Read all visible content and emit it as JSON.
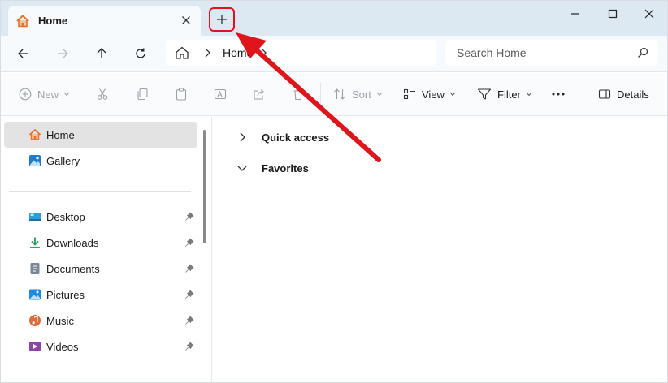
{
  "window": {
    "tab_title": "Home",
    "new_tab_label": "+"
  },
  "address_bar": {
    "crumb": "Home",
    "search_placeholder": "Search Home"
  },
  "command_bar": {
    "new_label": "New",
    "sort_label": "Sort",
    "view_label": "View",
    "filter_label": "Filter",
    "more_label": "···",
    "details_label": "Details"
  },
  "sidebar": {
    "top_items": [
      {
        "label": "Home",
        "icon": "home-icon",
        "selected": true
      },
      {
        "label": "Gallery",
        "icon": "gallery-icon",
        "selected": false
      }
    ],
    "pinned_items": [
      {
        "label": "Desktop",
        "icon": "desktop-icon",
        "pinned": true
      },
      {
        "label": "Downloads",
        "icon": "downloads-icon",
        "pinned": true
      },
      {
        "label": "Documents",
        "icon": "documents-icon",
        "pinned": true
      },
      {
        "label": "Pictures",
        "icon": "pictures-icon",
        "pinned": true
      },
      {
        "label": "Music",
        "icon": "music-icon",
        "pinned": true
      },
      {
        "label": "Videos",
        "icon": "videos-icon",
        "pinned": true
      }
    ]
  },
  "main": {
    "groups": [
      {
        "title": "Quick access",
        "expanded": false
      },
      {
        "title": "Favorites",
        "expanded": true
      }
    ]
  },
  "annotation": {
    "highlight_color": "#e0141b",
    "arrow_color": "#e0141b"
  },
  "colors": {
    "titlebar_bg": "#dce9f2",
    "selected_bg": "#e3e3e3",
    "home_icon_orange": "#e8702a"
  }
}
